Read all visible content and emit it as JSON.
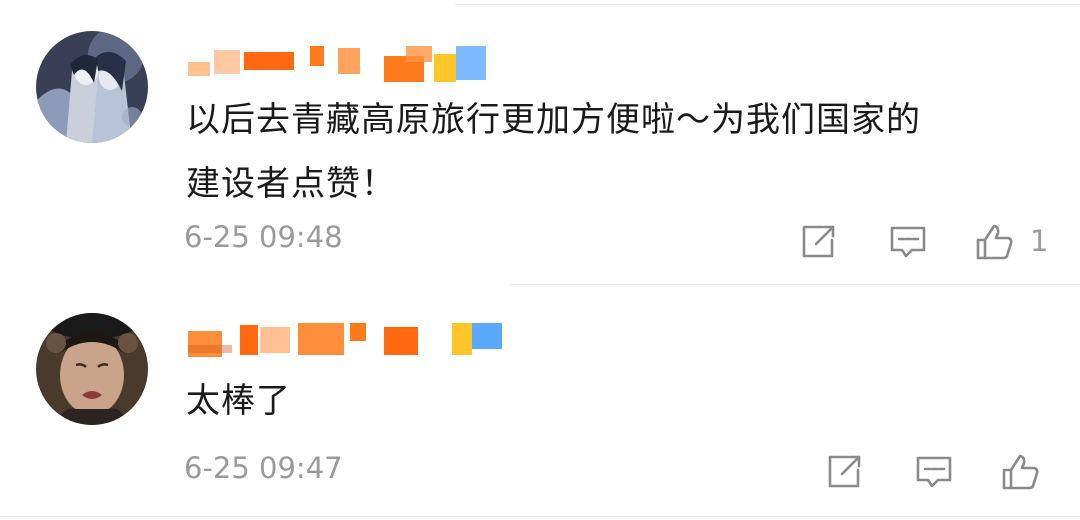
{
  "comments": [
    {
      "text_line1": "以后去青藏高原旅行更加方便啦～为我们国家的",
      "text_line2": "建设者点赞！",
      "time": "6-25 09:48",
      "like_count": "1",
      "icons": [
        "share-icon",
        "comment-icon",
        "like-icon"
      ]
    },
    {
      "text_line1": "太棒了",
      "time": "6-25 09:47",
      "like_count": "",
      "icons": [
        "share-icon",
        "comment-icon",
        "like-icon"
      ]
    }
  ],
  "colors": {
    "text": "#1a1a1a",
    "meta": "#9b9b9b",
    "icon": "#8a8a8a",
    "divider": "#e9e9e9",
    "blur_orange": "#ff7a1a",
    "blur_yellow": "#ffc629",
    "blur_blue": "#5aa8ff"
  }
}
